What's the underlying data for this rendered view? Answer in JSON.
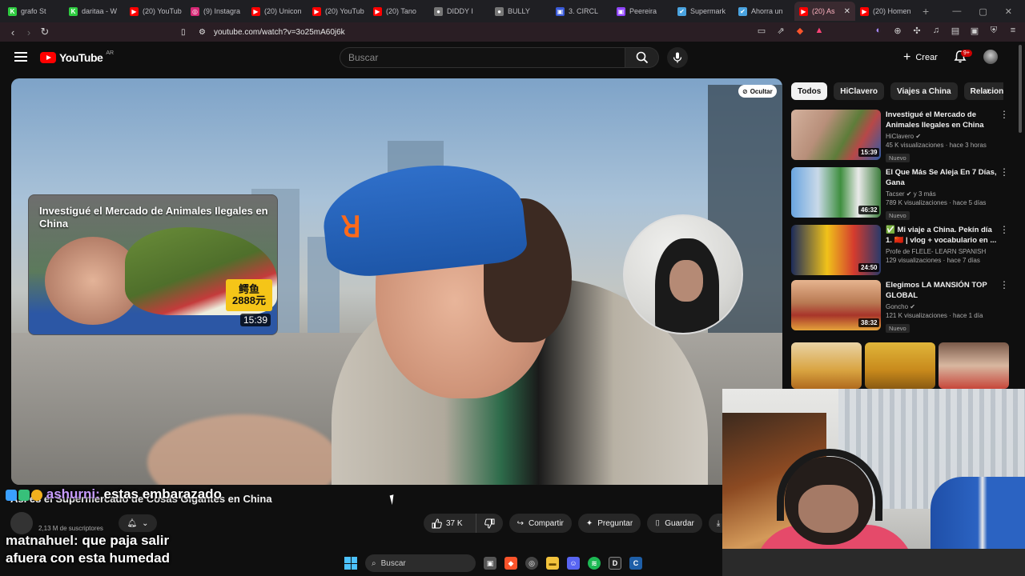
{
  "browser": {
    "tabs": [
      {
        "label": "grafo St",
        "color": "#2ecc40",
        "glyph": "K"
      },
      {
        "label": "daritaa - W",
        "color": "#2ecc40",
        "glyph": "K"
      },
      {
        "label": "(20) YouTub",
        "color": "#ff0000",
        "glyph": "▶"
      },
      {
        "label": "(9) Instagra",
        "color": "#d62976",
        "glyph": "◎"
      },
      {
        "label": "(20) Unicon",
        "color": "#ff0000",
        "glyph": "▶"
      },
      {
        "label": "(20) YouTub",
        "color": "#ff0000",
        "glyph": "▶"
      },
      {
        "label": "(20) Tano",
        "color": "#ff0000",
        "glyph": "▶"
      },
      {
        "label": "DIDDY I",
        "color": "#777777",
        "glyph": "●"
      },
      {
        "label": "BULLY",
        "color": "#777777",
        "glyph": "●"
      },
      {
        "label": "3. CIRCL",
        "color": "#3a5bd9",
        "glyph": "▣"
      },
      {
        "label": "Peereira",
        "color": "#9146ff",
        "glyph": "▣"
      },
      {
        "label": "Supermark",
        "color": "#4aa3df",
        "glyph": "✔"
      },
      {
        "label": "Ahorra un",
        "color": "#4aa3df",
        "glyph": "✔"
      },
      {
        "label": "(20) As",
        "color": "#ff0000",
        "glyph": "▶",
        "active": true
      },
      {
        "label": "(20) Homen",
        "color": "#ff0000",
        "glyph": "▶"
      }
    ],
    "url": "youtube.com/watch?v=3o25mA60j6k"
  },
  "header": {
    "logo_text": "YouTube",
    "country": "AR",
    "search_placeholder": "Buscar",
    "create_label": "Crear",
    "notif_badge": "9+"
  },
  "player": {
    "hide_label": "Ocultar",
    "endcard": {
      "title": "Investigué el Mercado de Animales Ilegales en China",
      "tag_line1": "鳄鱼",
      "tag_line2": "2888元",
      "duration": "15:39"
    }
  },
  "video": {
    "title": "Así es el Supermercado de Cosas Gigantes en China",
    "subscribers": "2,13 M de suscriptores",
    "likes": "37 K",
    "share_label": "Compartir",
    "ask_label": "Preguntar",
    "save_label": "Guardar",
    "download_label": "D"
  },
  "chat": [
    {
      "user": "ashurni:",
      "text": " estas embarazado"
    },
    {
      "user": "matnahuel:",
      "text": " que paja salir afuera con esta humedad"
    }
  ],
  "sidebar": {
    "chips": [
      "Todos",
      "HiClavero",
      "Viajes a China",
      "Relacionados"
    ],
    "recs": [
      {
        "title": "Investigué el Mercado de Animales Ilegales en China",
        "channel": "HiClavero",
        "verified": true,
        "meta": "45 K visualizaciones · hace 3 horas",
        "badge": "Nuevo",
        "duration": "15:39"
      },
      {
        "title": "El Que Más Se Aleja En 7 Días, Gana",
        "channel": "Tacser",
        "verified": true,
        "channel_suffix": " y 3 más",
        "meta": "789 K visualizaciones · hace 5 días",
        "badge": "Nuevo",
        "duration": "46:32"
      },
      {
        "title": "✅ Mi viaje a China. Pekín día 1. 🇨🇳 | vlog + vocabulario en ...",
        "channel": "Profe de FLELE- LEARN SPANISH",
        "verified": false,
        "meta": "129 visualizaciones · hace 7 días",
        "badge": "",
        "duration": "24:50"
      },
      {
        "title": "Elegimos LA MANSIÓN TOP GLOBAL",
        "channel": "Goncho",
        "verified": true,
        "meta": "121 K visualizaciones · hace 1 día",
        "badge": "Nuevo",
        "duration": "38:32"
      }
    ]
  },
  "taskbar": {
    "search_placeholder": "Buscar"
  }
}
